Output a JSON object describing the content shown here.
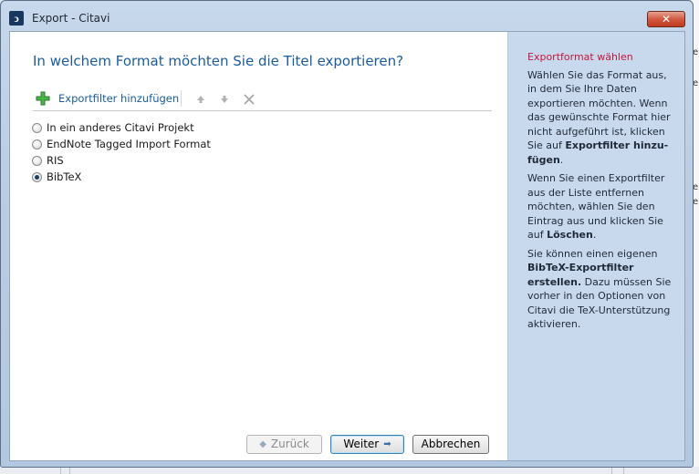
{
  "window": {
    "title": "Export - Citavi",
    "app_icon_glyph": "ͻ",
    "close_glyph": "✕"
  },
  "main": {
    "heading": "In welchem Format möchten Sie die Titel exportieren?",
    "toolbar": {
      "add_filter_label": "Exportfilter hinzufügen",
      "icons": [
        "plus-icon",
        "move-up-icon",
        "move-down-icon",
        "delete-icon"
      ]
    },
    "options": [
      {
        "label": "In ein anderes Citavi Projekt",
        "selected": false
      },
      {
        "label": "EndNote Tagged Import Format",
        "selected": false
      },
      {
        "label": "RIS",
        "selected": false
      },
      {
        "label": "BibTeX",
        "selected": true
      }
    ]
  },
  "buttons": {
    "back": "Zurück",
    "back_arrow": "◆",
    "next": "Weiter",
    "next_arrow": "➡",
    "cancel": "Abbrechen"
  },
  "side": {
    "title": "Exportformat wählen",
    "p1_text": "Wählen Sie das Format aus, in dem Sie Ihre Daten exportieren möchten. Wenn das gewünschte Format hier nicht aufgeführt ist, klicken Sie auf ",
    "p1_bold": "Exportfilter hinzu-fügen",
    "p1_end": ".",
    "p2_text": "Wenn Sie einen Exportfilter aus der Liste entfernen möchten, wählen Sie den Eintrag aus und klicken Sie auf ",
    "p2_bold": "Löschen",
    "p2_end": ".",
    "p3_text": "Sie können einen eigenen ",
    "p3_bold": "BibTeX-Exportfilter erstellen.",
    "p3_end": " Dazu müssen Sie vorher in den Optionen von Citavi die TeX-Unterstützung aktivieren."
  },
  "colors": {
    "heading": "#1a5c9e",
    "side_title": "#c2183c",
    "side_bg": "#c9d9ed",
    "accent_green": "#3aa13a"
  },
  "background": {
    "right_edge_marks": [
      "e",
      "e",
      "e",
      "e"
    ]
  }
}
